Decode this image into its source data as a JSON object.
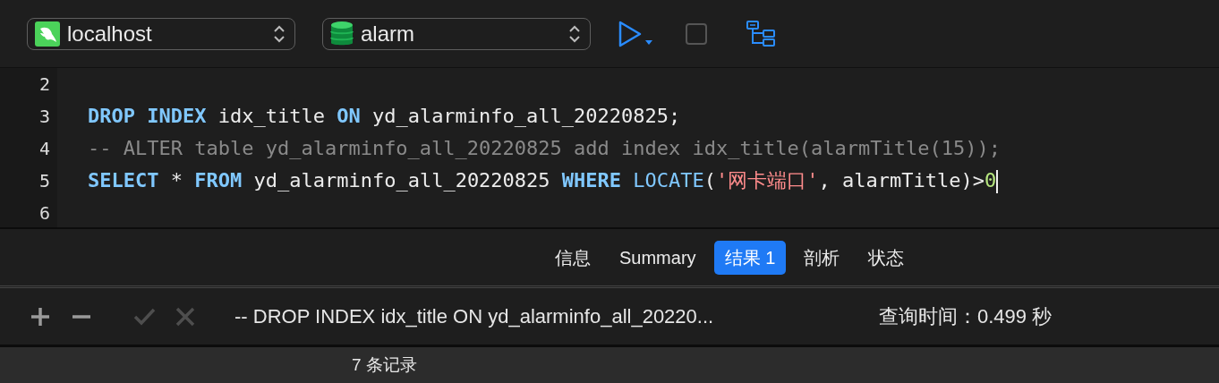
{
  "toolbar": {
    "connection": {
      "label": "localhost"
    },
    "database": {
      "label": "alarm"
    }
  },
  "editor": {
    "lines": [
      {
        "number": "2",
        "cursor": false
      },
      {
        "number": "3",
        "cursor": false,
        "tokens": [
          {
            "kind": "keyword",
            "text": "DROP INDEX"
          },
          {
            "kind": "plain",
            "text": " idx_title "
          },
          {
            "kind": "keyword",
            "text": "ON"
          },
          {
            "kind": "plain",
            "text": " yd_alarminfo_all_20220825;"
          }
        ]
      },
      {
        "number": "4",
        "cursor": false,
        "tokens": [
          {
            "kind": "comment",
            "text": "-- ALTER table yd_alarminfo_all_20220825 add index idx_title(alarmTitle(15));"
          }
        ]
      },
      {
        "number": "5",
        "cursor": true,
        "tokens": [
          {
            "kind": "keyword",
            "text": "SELECT"
          },
          {
            "kind": "plain",
            "text": " * "
          },
          {
            "kind": "keyword",
            "text": "FROM"
          },
          {
            "kind": "plain",
            "text": " yd_alarminfo_all_20220825 "
          },
          {
            "kind": "keyword",
            "text": "WHERE"
          },
          {
            "kind": "function",
            "text": " LOCATE"
          },
          {
            "kind": "plain",
            "text": "("
          },
          {
            "kind": "string",
            "text": "'网卡端口'"
          },
          {
            "kind": "plain",
            "text": ", alarmTitle)>"
          },
          {
            "kind": "number",
            "text": "0"
          }
        ]
      },
      {
        "number": "6",
        "cursor": false
      }
    ]
  },
  "tabs": [
    {
      "label": "信息",
      "selected": false
    },
    {
      "label": "Summary",
      "selected": false
    },
    {
      "label": "结果 1",
      "selected": true
    },
    {
      "label": "剖析",
      "selected": false
    },
    {
      "label": "状态",
      "selected": false
    }
  ],
  "result_bar": {
    "buttons": [
      {
        "kind": "add",
        "disabled": false
      },
      {
        "kind": "remove",
        "disabled": false
      },
      {
        "kind": "apply",
        "disabled": true
      },
      {
        "kind": "discard",
        "disabled": true
      }
    ],
    "message": "-- DROP INDEX idx_title ON yd_alarminfo_all_20220...",
    "query_time": "查询时间：0.499 秒"
  },
  "status_bar": {
    "records": "7 条记录"
  }
}
